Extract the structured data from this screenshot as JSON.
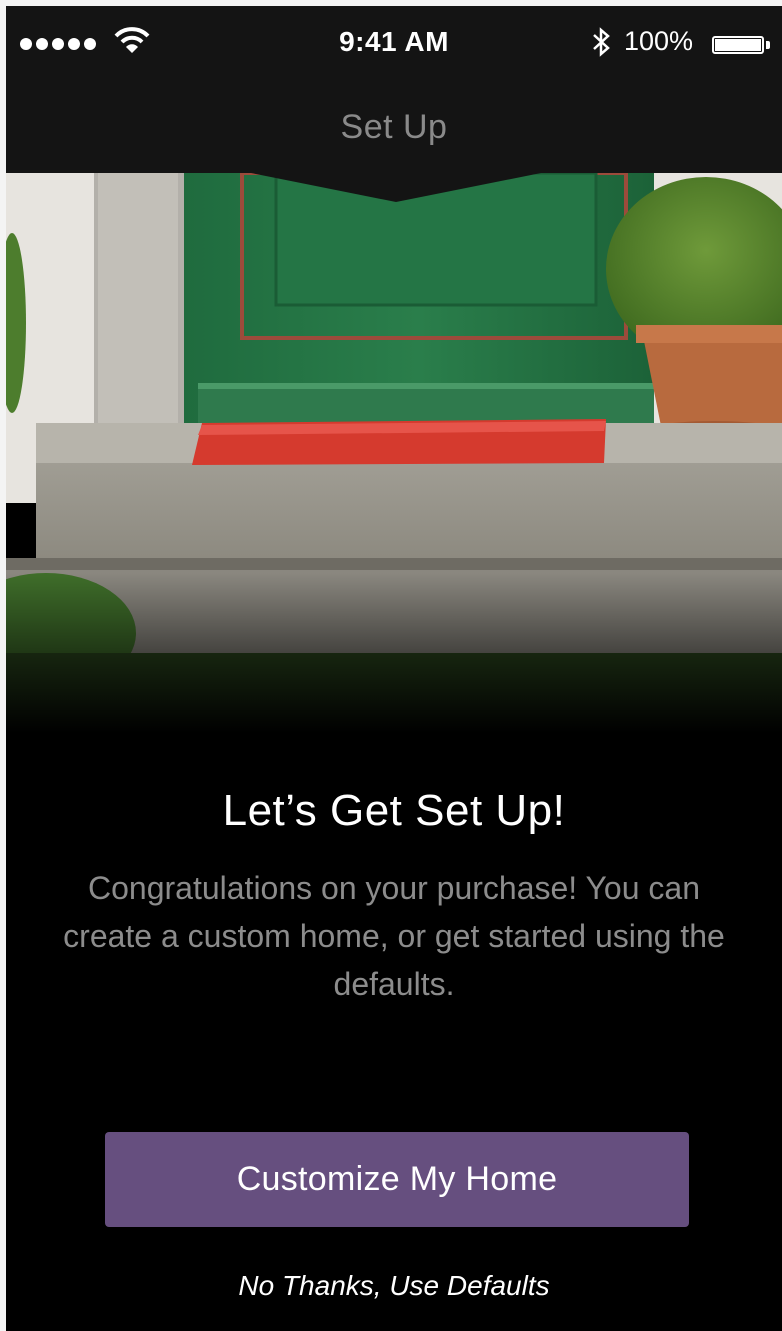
{
  "status_bar": {
    "time": "9:41 AM",
    "battery_percent": "100%",
    "battery_level": 1.0,
    "signal_bars": 5
  },
  "nav": {
    "title": "Set Up"
  },
  "hero": {
    "description_icon": "front-door-photo"
  },
  "content": {
    "headline": "Let’s Get Set Up!",
    "body": "Congratulations on your purchase!  You can create a custom home, or get started using the defaults."
  },
  "actions": {
    "primary_label": "Customize My Home",
    "secondary_label": "No Thanks, Use Defaults"
  },
  "colors": {
    "accent": "#664f7f",
    "background": "#000000",
    "bar": "#141414"
  }
}
